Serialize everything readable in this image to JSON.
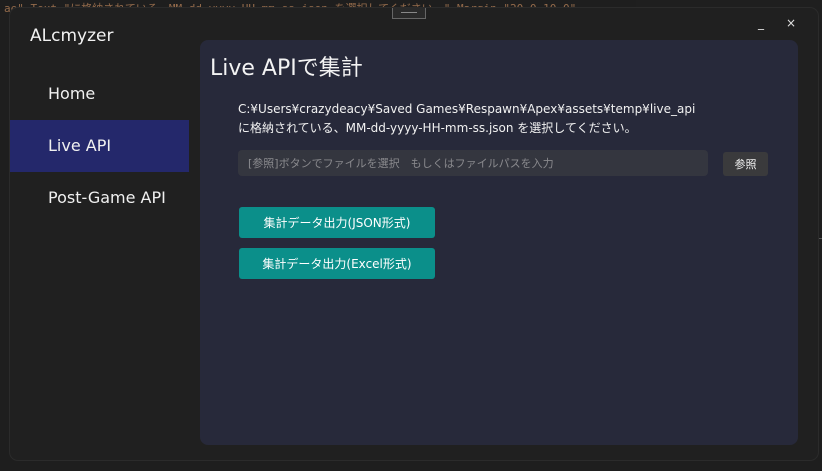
{
  "background": {
    "editor_text": "ae\" Text=\"に格納されている、MM-dd-yyyy-HH-mm-ss.json を選択してください。\" Margin=\"20,0,10,0\""
  },
  "window": {
    "minimize_glyph": "_",
    "close_glyph": "×"
  },
  "app": {
    "title": "ALcmyzer"
  },
  "sidebar": {
    "items": [
      {
        "label": "Home",
        "active": false
      },
      {
        "label": "Live API",
        "active": true
      },
      {
        "label": "Post-Game API",
        "active": false
      }
    ]
  },
  "main": {
    "title": "Live APIで集計",
    "description_line1": "C:¥Users¥crazydeacy¥Saved Games¥Respawn¥Apex¥assets¥temp¥live_api",
    "description_line2": "に格納されている、MM-dd-yyyy-HH-mm-ss.json を選択してください。",
    "path_input": {
      "value": "",
      "placeholder": "[参照]ボタンでファイルを選択　もしくはファイルパスを入力"
    },
    "browse_label": "参照",
    "export_json_label": "集計データ出力(JSON形式)",
    "export_excel_label": "集計データ出力(Excel形式)"
  },
  "colors": {
    "accent": "#0b8f8a",
    "nav_active": "#24286b",
    "content_bg": "#27293a"
  }
}
